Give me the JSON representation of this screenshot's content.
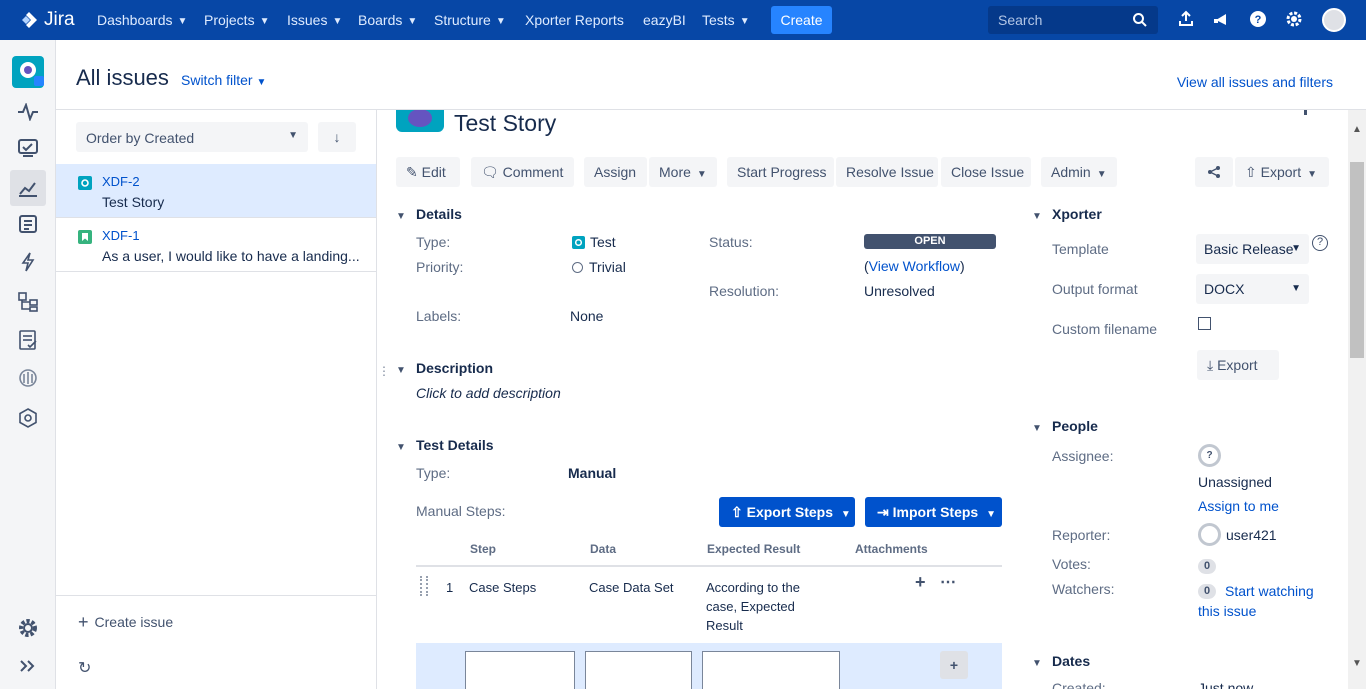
{
  "topnav": {
    "logo": "Jira",
    "items": [
      "Dashboards",
      "Projects",
      "Issues",
      "Boards",
      "Structure",
      "Xporter Reports",
      "eazyBI",
      "Tests"
    ],
    "create": "Create",
    "search_placeholder": "Search"
  },
  "header": {
    "title": "All issues",
    "switch_filter": "Switch filter",
    "view_all": "View all issues and filters"
  },
  "list": {
    "order_by": "Order by Created",
    "issues": [
      {
        "key": "XDF-2",
        "summary": "Test Story"
      },
      {
        "key": "XDF-1",
        "summary": "As a user, I would like to have a landing..."
      }
    ],
    "create_issue": "Create issue"
  },
  "issue": {
    "title": "Test Story",
    "buttons": {
      "edit": "Edit",
      "comment": "Comment",
      "assign": "Assign",
      "more": "More",
      "start_progress": "Start Progress",
      "resolve": "Resolve Issue",
      "close": "Close Issue",
      "admin": "Admin",
      "export": "Export"
    },
    "details": {
      "heading": "Details",
      "type_label": "Type:",
      "type_value": "Test",
      "priority_label": "Priority:",
      "priority_value": "Trivial",
      "labels_label": "Labels:",
      "labels_value": "None",
      "status_label": "Status:",
      "status_value": "OPEN",
      "workflow_open": "(",
      "workflow_link": "View Workflow",
      "workflow_close": ")",
      "resolution_label": "Resolution:",
      "resolution_value": "Unresolved"
    },
    "description": {
      "heading": "Description",
      "placeholder": "Click to add description"
    },
    "test_details": {
      "heading": "Test Details",
      "type_label": "Type:",
      "type_value": "Manual",
      "steps_label": "Manual Steps:",
      "export_steps": "Export Steps",
      "import_steps": "Import Steps",
      "columns": [
        "Step",
        "Data",
        "Expected Result",
        "Attachments"
      ],
      "steps": [
        {
          "num": "1",
          "step": "Case Steps",
          "data": "Case Data Set",
          "expected": "According to the case, Expected Result"
        }
      ]
    },
    "xporter": {
      "heading": "Xporter",
      "template_label": "Template",
      "template_value": "Basic Release",
      "output_label": "Output format",
      "output_value": "DOCX",
      "custom_label": "Custom filename",
      "export_btn": "Export"
    },
    "people": {
      "heading": "People",
      "assignee_label": "Assignee:",
      "assignee_value": "Unassigned",
      "assign_to_me": "Assign to me",
      "reporter_label": "Reporter:",
      "reporter_value": "user421",
      "votes_label": "Votes:",
      "votes_count": "0",
      "watchers_label": "Watchers:",
      "watchers_count": "0",
      "start_watching": "Start watching this issue"
    },
    "dates": {
      "heading": "Dates",
      "created_label": "Created:",
      "created_value": "Just now"
    }
  }
}
